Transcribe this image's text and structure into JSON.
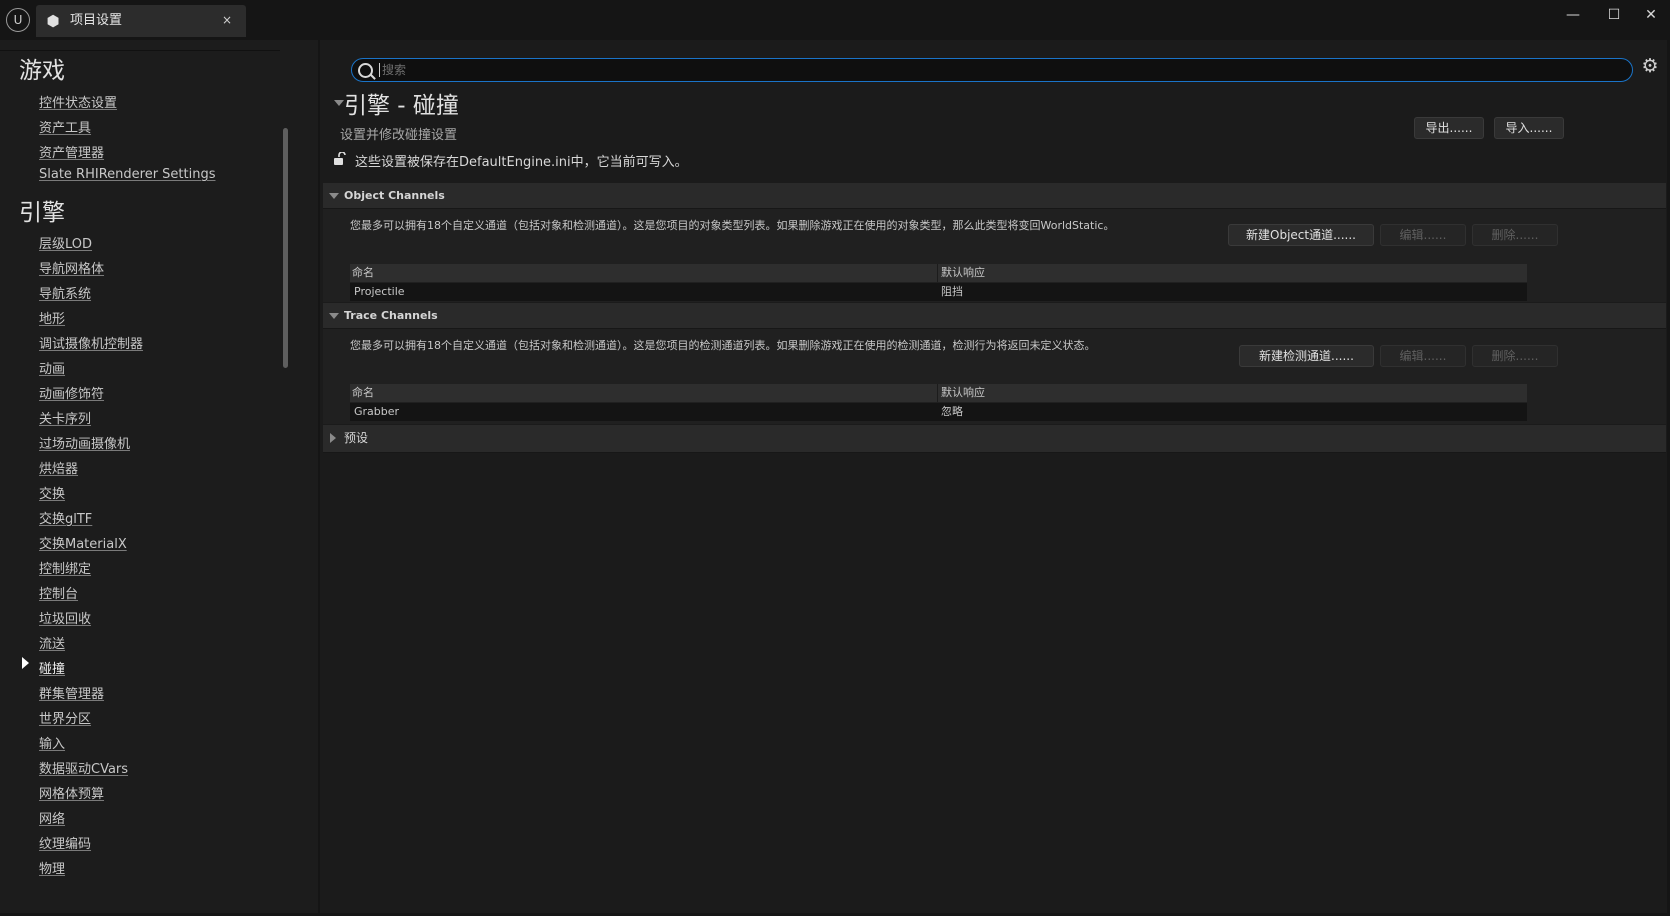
{
  "titlebar": {
    "logo": "U",
    "tab_label": "项目设置",
    "tab_close": "×",
    "minimize": "—",
    "maximize": "☐",
    "close": "✕"
  },
  "sidebar": {
    "sections": [
      {
        "title": "游戏",
        "items": [
          "控件状态设置",
          "资产工具",
          "资产管理器",
          "Slate RHIRenderer Settings"
        ]
      },
      {
        "title": "引擎",
        "items": [
          "层级LOD",
          "导航网格体",
          "导航系统",
          "地形",
          "调试摄像机控制器",
          "动画",
          "动画修饰符",
          "关卡序列",
          "过场动画摄像机",
          "烘焙器",
          "交换",
          "交换glTF",
          "交换MaterialX",
          "控制绑定",
          "控制台",
          "垃圾回收",
          "流送",
          "碰撞",
          "群集管理器",
          "世界分区",
          "输入",
          "数据驱动CVars",
          "网格体预算",
          "网络",
          "纹理编码",
          "物理"
        ]
      }
    ],
    "active_item": "碰撞"
  },
  "search": {
    "placeholder": "搜索",
    "value": ""
  },
  "page": {
    "title": "引擎 - 碰撞",
    "subtitle": "设置并修改碰撞设置",
    "export_label": "导出......",
    "import_label": "导入......",
    "notice": "这些设置被保存在DefaultEngine.ini中，它当前可写入。"
  },
  "object_channels": {
    "header": "Object Channels",
    "description": "您最多可以拥有18个自定义通道（包括对象和检测通道）。这是您项目的对象类型列表。如果删除游戏正在使用的对象类型，那么此类型将变回WorldStatic。",
    "new_label": "新建Object通道......",
    "edit_label": "编辑......",
    "delete_label": "删除......",
    "col_name": "命名",
    "col_response": "默认响应",
    "rows": [
      {
        "name": "Projectile",
        "response": "阻挡"
      }
    ]
  },
  "trace_channels": {
    "header": "Trace Channels",
    "description": "您最多可以拥有18个自定义通道（包括对象和检测通道）。这是您项目的检测通道列表。如果删除游戏正在使用的检测通道，检测行为将返回未定义状态。",
    "new_label": "新建检测通道......",
    "edit_label": "编辑......",
    "delete_label": "删除......",
    "col_name": "命名",
    "col_response": "默认响应",
    "rows": [
      {
        "name": "Grabber",
        "response": "忽略"
      }
    ]
  },
  "presets": {
    "header": "预设"
  }
}
